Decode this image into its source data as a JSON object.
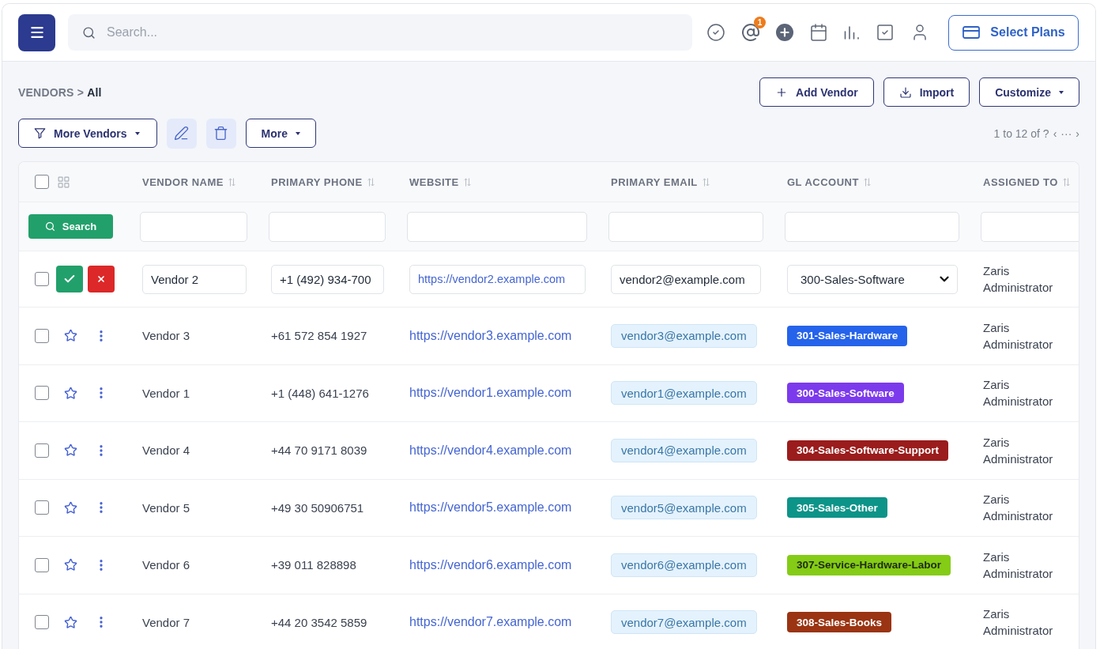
{
  "header": {
    "search": {
      "placeholder": "Search..."
    },
    "mentions_badge": "1",
    "plans_button": "Select Plans"
  },
  "page": {
    "breadcrumb": "VENDORS > **All**",
    "actions": [
      {
        "kind": "add",
        "label": "Add Vendor"
      },
      {
        "kind": "import",
        "label": "Import"
      },
      {
        "kind": "dropdown",
        "label": "Customize"
      }
    ],
    "toolbar": {
      "filter_button": "More Vendors",
      "more_button": "More"
    },
    "pagination": {
      "summary": "1 to 12 of ?",
      "prev": "‹",
      "ellipsis": "···",
      "next": "›"
    }
  },
  "table": {
    "select_all_checked": false,
    "columns": [
      "VENDOR NAME",
      "PRIMARY PHONE",
      "WEBSITE",
      "PRIMARY EMAIL",
      "GL ACCOUNT",
      "ASSIGNED TO"
    ],
    "filter_button": "Search",
    "rows": [
      {
        "kind": "editing",
        "checked": false,
        "vendor_name": "Vendor 2",
        "primary_phone": "+1 (492) 934-700",
        "website": "https://vendor2.example.com",
        "primary_email": "vendor2@example.com",
        "gl_account": "300-Sales-Software",
        "assigned_to": "Zaris Administrator"
      },
      {
        "kind": "display",
        "checked": false,
        "starred": false,
        "vendor_name": "Vendor 3",
        "primary_phone": "+61 572 854 1927",
        "website": "https://vendor3.example.com",
        "primary_email": "vendor3@example.com",
        "gl_account": "301-Sales-Hardware",
        "color": "#2563eb",
        "assigned_to": "Zaris Administrator"
      },
      {
        "kind": "display",
        "checked": false,
        "starred": false,
        "vendor_name": "Vendor 1",
        "primary_phone": "+1 (448) 641-1276",
        "website": "https://vendor1.example.com",
        "primary_email": "vendor1@example.com",
        "gl_account": "300-Sales-Software",
        "color": "#7c3aed",
        "assigned_to": "Zaris Administrator"
      },
      {
        "kind": "display",
        "checked": false,
        "starred": false,
        "vendor_name": "Vendor 4",
        "primary_phone": "+44 70 9171 8039",
        "website": "https://vendor4.example.com",
        "primary_email": "vendor4@example.com",
        "gl_account": "304-Sales-Software-Support",
        "color": "#9b1c1c",
        "assigned_to": "Zaris Administrator"
      },
      {
        "kind": "display",
        "checked": false,
        "starred": false,
        "vendor_name": "Vendor 5",
        "primary_phone": "+49 30 50906751",
        "website": "https://vendor5.example.com",
        "primary_email": "vendor5@example.com",
        "gl_account": "305-Sales-Other",
        "color": "#0d9488",
        "assigned_to": "Zaris Administrator"
      },
      {
        "kind": "display",
        "checked": false,
        "starred": false,
        "vendor_name": "Vendor 6",
        "primary_phone": "+39 011 828898",
        "website": "https://vendor6.example.com",
        "primary_email": "vendor6@example.com",
        "gl_account": "307-Service-Hardware-Labor",
        "color": "#84cc16",
        "assigned_to": "Zaris Administrator"
      },
      {
        "kind": "display",
        "checked": false,
        "starred": false,
        "vendor_name": "Vendor 7",
        "primary_phone": "+44 20 3542 5859",
        "website": "https://vendor7.example.com",
        "primary_email": "vendor7@example.com",
        "gl_account": "308-Sales-Books",
        "color": "#9a3412",
        "assigned_to": "Zaris Administrator"
      }
    ]
  }
}
